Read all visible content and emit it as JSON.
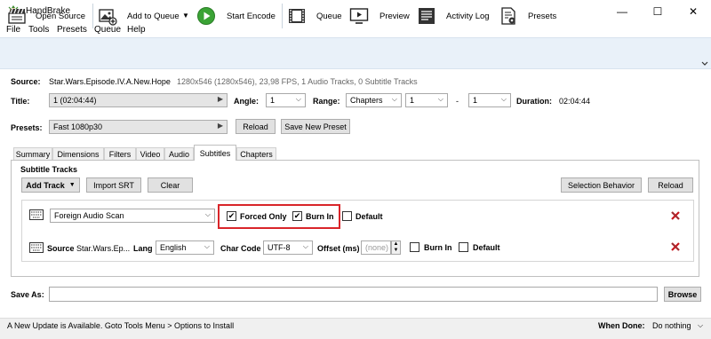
{
  "window": {
    "title": "HandBrake",
    "minimize_glyph": "—",
    "maximize_glyph": "☐",
    "close_glyph": "✕"
  },
  "menu": [
    "File",
    "Tools",
    "Presets",
    "Queue",
    "Help"
  ],
  "toolbar": {
    "open_source": "Open Source",
    "add_to_queue": "Add to Queue",
    "start_encode": "Start Encode",
    "queue": "Queue",
    "preview": "Preview",
    "activity_log": "Activity Log",
    "presets": "Presets"
  },
  "source": {
    "label": "Source:",
    "name": "Star.Wars.Episode.IV.A.New.Hope",
    "info": "1280x546 (1280x546), 23,98 FPS, 1 Audio Tracks, 0 Subtitle Tracks"
  },
  "title_row": {
    "title_label": "Title:",
    "title_value": "1 (02:04:44)",
    "angle_label": "Angle:",
    "angle_value": "1",
    "range_label": "Range:",
    "range_value": "Chapters",
    "range_start": "1",
    "range_dash": "-",
    "range_end": "1",
    "duration_label": "Duration:",
    "duration_value": "02:04:44"
  },
  "presets_row": {
    "label": "Presets:",
    "value": "Fast 1080p30",
    "reload": "Reload",
    "save_new": "Save New Preset"
  },
  "tabs": [
    "Summary",
    "Dimensions",
    "Filters",
    "Video",
    "Audio",
    "Subtitles",
    "Chapters"
  ],
  "active_tab": "Subtitles",
  "subtitles": {
    "section_title": "Subtitle Tracks",
    "add_track": "Add Track",
    "import_srt": "Import SRT",
    "clear": "Clear",
    "selection_behavior": "Selection Behavior",
    "reload": "Reload",
    "track1": {
      "source_value": "Foreign Audio Scan",
      "forced_only": "Forced Only",
      "forced_only_checked": true,
      "burn_in": "Burn In",
      "burn_in_checked": true,
      "default": "Default",
      "default_checked": false
    },
    "track2": {
      "source_label": "Source",
      "source_value": "Star.Wars.Ep...",
      "lang_label": "Lang",
      "lang_value": "English",
      "charcode_label": "Char Code",
      "charcode_value": "UTF-8",
      "offset_label": "Offset (ms)",
      "offset_placeholder": "(none)",
      "burn_in": "Burn In",
      "burn_in_checked": false,
      "default": "Default",
      "default_checked": false
    }
  },
  "save_as": {
    "label": "Save As:",
    "value": "",
    "browse": "Browse"
  },
  "status": {
    "message": "A New Update is Available. Goto Tools Menu > Options to Install",
    "when_done_label": "When Done:",
    "when_done_value": "Do nothing"
  },
  "colors": {
    "toolbar_bg": "#e9f1f9",
    "highlight": "#d9252a",
    "start_green": "#3aa335",
    "delete_red": "#c8161d"
  },
  "icons": {
    "app": "handbrake-pineapple-icon",
    "open_source": "film-clapper-icon",
    "add_to_queue": "add-image-icon",
    "start_encode": "play-icon",
    "queue": "film-strip-icon",
    "preview": "tv-play-icon",
    "activity_log": "log-console-icon",
    "presets": "document-gear-icon",
    "subtitle_track": "keyboard-icon",
    "delete": "red-x-icon"
  }
}
